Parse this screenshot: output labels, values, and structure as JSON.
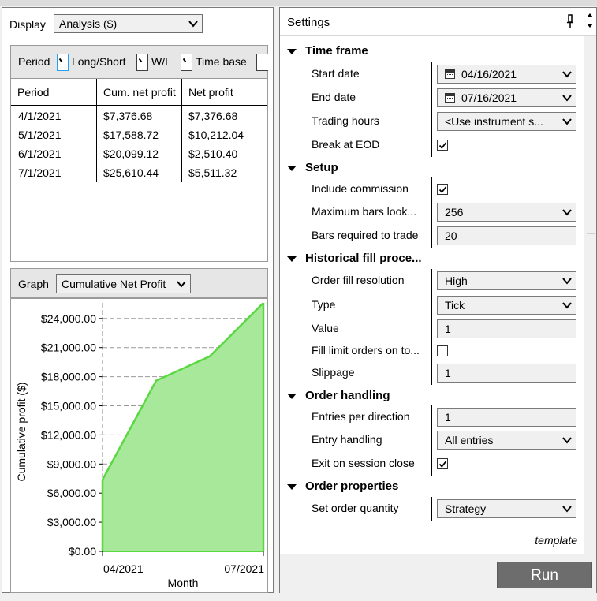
{
  "display": {
    "label": "Display",
    "selected": "Analysis ($)"
  },
  "tabs": {
    "items": [
      "Period",
      "Long/Short",
      "W/L",
      "Time base"
    ]
  },
  "period_table": {
    "headers": [
      "Period",
      "Cum. net profit",
      "Net profit"
    ],
    "rows": [
      [
        "4/1/2021",
        "$7,376.68",
        "$7,376.68"
      ],
      [
        "5/1/2021",
        "$17,588.72",
        "$10,212.04"
      ],
      [
        "6/1/2021",
        "$20,099.12",
        "$2,510.40"
      ],
      [
        "7/1/2021",
        "$25,610.44",
        "$5,511.32"
      ]
    ]
  },
  "graph": {
    "label": "Graph",
    "selected": "Cumulative Net Profit"
  },
  "chart_data": {
    "type": "area",
    "x": [
      "4/1/2021",
      "5/1/2021",
      "6/1/2021",
      "7/1/2021"
    ],
    "values": [
      7376.68,
      17588.72,
      20099.12,
      25610.44
    ],
    "ylabel": "Cumulative profit ($)",
    "xlabel": "Month",
    "y_ticks": [
      "$0.00",
      "$3,000.00",
      "$6,000.00",
      "$9,000.00",
      "$12,000.00",
      "$15,000.00",
      "$18,000.00",
      "$21,000.00",
      "$24,000.00"
    ],
    "y_tick_values": [
      0,
      3000,
      6000,
      9000,
      12000,
      15000,
      18000,
      21000,
      24000
    ],
    "x_tick_labels": [
      "04/2021",
      "07/2021"
    ],
    "ylim": [
      0,
      25610.44
    ],
    "grid": true,
    "fill_color": "#a8e89a",
    "line_color": "#5ad842"
  },
  "settings": {
    "title": "Settings",
    "sections": {
      "time_frame": {
        "title": "Time frame",
        "start_date_label": "Start date",
        "start_date": "04/16/2021",
        "end_date_label": "End date",
        "end_date": "07/16/2021",
        "trading_hours_label": "Trading hours",
        "trading_hours": "<Use instrument s...",
        "break_eod_label": "Break at EOD",
        "break_eod": true
      },
      "setup": {
        "title": "Setup",
        "include_commission_label": "Include commission",
        "include_commission": true,
        "max_bars_label": "Maximum bars look...",
        "max_bars": "256",
        "bars_required_label": "Bars required to trade",
        "bars_required": "20"
      },
      "fill": {
        "title": "Historical fill proce...",
        "resolution_label": "Order fill resolution",
        "resolution": "High",
        "type_label": "Type",
        "type": "Tick",
        "value_label": "Value",
        "value": "1",
        "fill_limit_label": "Fill limit orders on to...",
        "fill_limit": false,
        "slippage_label": "Slippage",
        "slippage": "1"
      },
      "order_handling": {
        "title": "Order handling",
        "entries_label": "Entries per direction",
        "entries": "1",
        "entry_handling_label": "Entry handling",
        "entry_handling": "All entries",
        "exit_close_label": "Exit on session close",
        "exit_close": true
      },
      "order_properties": {
        "title": "Order properties",
        "quantity_label": "Set order quantity",
        "quantity": "Strategy"
      }
    },
    "template_label": "template",
    "run_label": "Run"
  }
}
